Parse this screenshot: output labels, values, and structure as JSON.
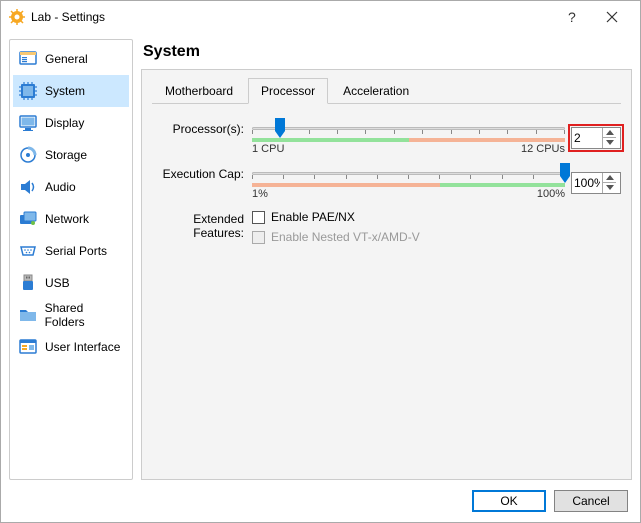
{
  "title": "Lab - Settings",
  "sidebar": {
    "items": [
      {
        "label": "General"
      },
      {
        "label": "System"
      },
      {
        "label": "Display"
      },
      {
        "label": "Storage"
      },
      {
        "label": "Audio"
      },
      {
        "label": "Network"
      },
      {
        "label": "Serial Ports"
      },
      {
        "label": "USB"
      },
      {
        "label": "Shared Folders"
      },
      {
        "label": "User Interface"
      }
    ],
    "active_index": 1
  },
  "section_heading": "System",
  "tabs": {
    "items": [
      {
        "label": "Motherboard"
      },
      {
        "label": "Processor"
      },
      {
        "label": "Acceleration"
      }
    ],
    "active_index": 1
  },
  "processors": {
    "label": "Processor(s):",
    "value": "2",
    "min_label": "1 CPU",
    "max_label": "12 CPUs",
    "slider_percent": 9,
    "green_percent": 50,
    "orange_percent": 50
  },
  "exec_cap": {
    "label": "Execution Cap:",
    "value": "100",
    "suffix": "%",
    "min_label": "1%",
    "max_label": "100%",
    "slider_percent": 100,
    "green_percent": 40,
    "orange_percent": 60
  },
  "extended": {
    "label": "Extended Features:",
    "pae_label": "Enable PAE/NX",
    "vtx_label": "Enable Nested VT-x/AMD-V"
  },
  "footer": {
    "ok": "OK",
    "cancel": "Cancel"
  },
  "colors": {
    "accent": "#0078d7",
    "highlight": "#e02020"
  }
}
